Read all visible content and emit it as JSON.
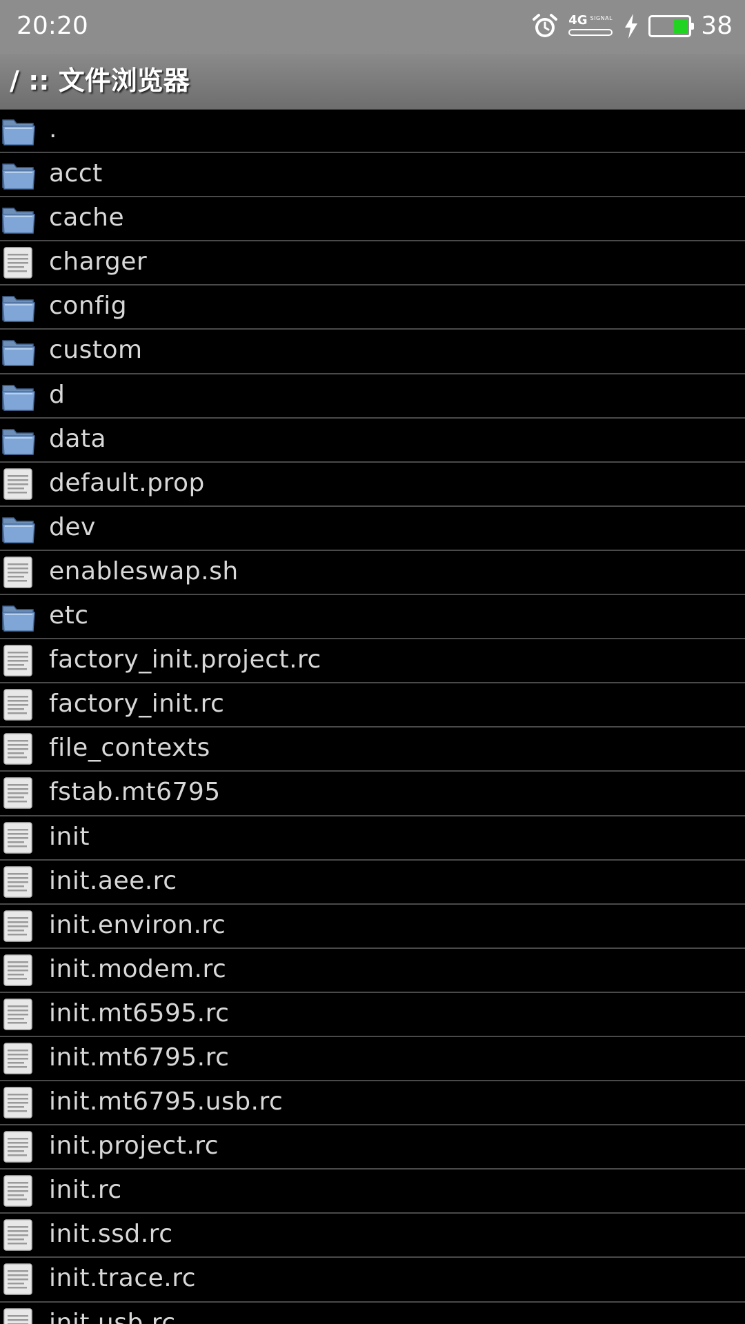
{
  "status_bar": {
    "time": "20:20",
    "network": "4G",
    "signal_label": "SIGNAL",
    "battery_percent": "38",
    "battery_level": 0.38,
    "battery_color": "#22d422"
  },
  "title_bar": {
    "title": "/ :: 文件浏览器"
  },
  "files": [
    {
      "name": ".",
      "type": "folder"
    },
    {
      "name": "acct",
      "type": "folder"
    },
    {
      "name": "cache",
      "type": "folder"
    },
    {
      "name": "charger",
      "type": "file"
    },
    {
      "name": "config",
      "type": "folder"
    },
    {
      "name": "custom",
      "type": "folder"
    },
    {
      "name": "d",
      "type": "folder"
    },
    {
      "name": "data",
      "type": "folder"
    },
    {
      "name": "default.prop",
      "type": "file"
    },
    {
      "name": "dev",
      "type": "folder"
    },
    {
      "name": "enableswap.sh",
      "type": "file"
    },
    {
      "name": "etc",
      "type": "folder"
    },
    {
      "name": "factory_init.project.rc",
      "type": "file"
    },
    {
      "name": "factory_init.rc",
      "type": "file"
    },
    {
      "name": "file_contexts",
      "type": "file"
    },
    {
      "name": "fstab.mt6795",
      "type": "file"
    },
    {
      "name": "init",
      "type": "file"
    },
    {
      "name": "init.aee.rc",
      "type": "file"
    },
    {
      "name": "init.environ.rc",
      "type": "file"
    },
    {
      "name": "init.modem.rc",
      "type": "file"
    },
    {
      "name": "init.mt6595.rc",
      "type": "file"
    },
    {
      "name": "init.mt6795.rc",
      "type": "file"
    },
    {
      "name": "init.mt6795.usb.rc",
      "type": "file"
    },
    {
      "name": "init.project.rc",
      "type": "file"
    },
    {
      "name": "init.rc",
      "type": "file"
    },
    {
      "name": "init.ssd.rc",
      "type": "file"
    },
    {
      "name": "init.trace.rc",
      "type": "file"
    },
    {
      "name": "init.usb.rc",
      "type": "file"
    }
  ],
  "icons": {
    "folder": "folder-icon",
    "file": "document-icon"
  }
}
